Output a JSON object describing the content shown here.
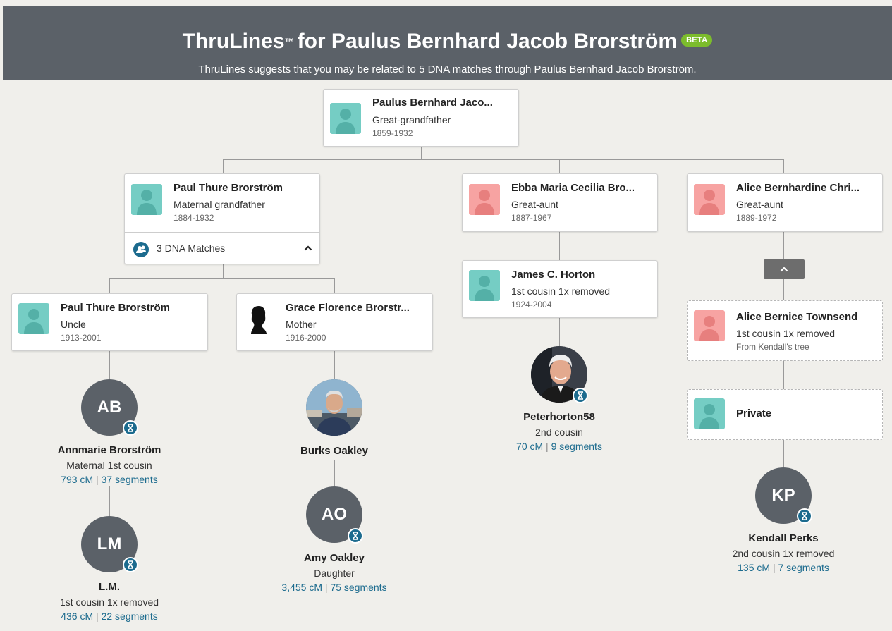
{
  "header": {
    "title_prefix": "ThruLines",
    "tm": "™",
    "title_rest": "for Paulus Bernhard Jacob Brorström",
    "beta": "BETA",
    "subtitle": "ThruLines suggests that you may be related to 5 DNA matches through Paulus Bernhard Jacob Brorström."
  },
  "ancestor": {
    "name": "Paulus Bernhard Jaco...",
    "relation": "Great-grandfather",
    "years": "1859-1932"
  },
  "branches": {
    "paul_sr": {
      "name": "Paul Thure Brorström",
      "relation": "Maternal grandfather",
      "years": "1884-1932",
      "dna_matches": "3 DNA Matches"
    },
    "ebba": {
      "name": "Ebba Maria Cecilia Bro...",
      "relation": "Great-aunt",
      "years": "1887-1967"
    },
    "alice": {
      "name": "Alice Bernhardine Chri...",
      "relation": "Great-aunt",
      "years": "1889-1972"
    },
    "paul_jr": {
      "name": "Paul Thure Brorström",
      "relation": "Uncle",
      "years": "1913-2001"
    },
    "grace": {
      "name": "Grace Florence Brorstr...",
      "relation": "Mother",
      "years": "1916-2000"
    },
    "james": {
      "name": "James C. Horton",
      "relation": "1st cousin 1x removed",
      "years": "1924-2004"
    },
    "alice_t": {
      "name": "Alice Bernice Townsend",
      "relation": "1st cousin 1x removed",
      "note": "From Kendall's tree"
    },
    "private": {
      "name": "Private"
    }
  },
  "matches": {
    "ab": {
      "initials": "AB",
      "name": "Annmarie Brorström",
      "relation": "Maternal 1st cousin",
      "cm": "793 cM",
      "segments": "37 segments"
    },
    "lm": {
      "initials": "LM",
      "name": "L.M.",
      "relation": "1st cousin 1x removed",
      "cm": "436 cM",
      "segments": "22 segments"
    },
    "burks": {
      "name": "Burks Oakley"
    },
    "ao": {
      "initials": "AO",
      "name": "Amy Oakley",
      "relation": "Daughter",
      "cm": "3,455 cM",
      "segments": "75 segments"
    },
    "peter": {
      "name": "Peterhorton58",
      "relation": "2nd cousin",
      "cm": "70 cM",
      "segments": "9 segments"
    },
    "kp": {
      "initials": "KP",
      "name": "Kendall Perks",
      "relation": "2nd cousin 1x removed",
      "cm": "135 cM",
      "segments": "7 segments"
    }
  },
  "ui": {
    "separator": "|"
  },
  "colors": {
    "header_bg": "#5b6168",
    "beta_green": "#7cbc2c",
    "male_avatar": "#75cdc4",
    "female_avatar": "#f7a3a2",
    "link_blue": "#1c6b8e",
    "match_circle": "#5b6168"
  }
}
